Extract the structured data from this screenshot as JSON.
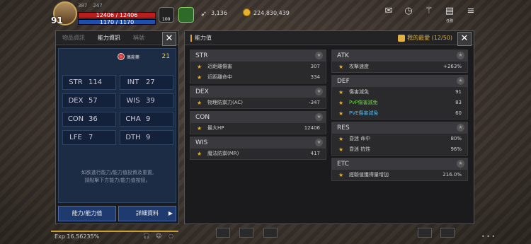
{
  "hud": {
    "level": "91",
    "hp_text": "12406 / 12406",
    "mp_text": "1170 / 1170",
    "stat_a": "387",
    "stat_b": "247",
    "wing_value": "3,136",
    "gold": "224,830,439",
    "pet_num": "100",
    "menu_labels": [
      "",
      "",
      "",
      "任務"
    ]
  },
  "left_panel": {
    "tabs": [
      "物品資訊",
      "能力資訊",
      "稱號"
    ],
    "elixir_label": "萬能藥",
    "elixir_value": "21",
    "stats": [
      {
        "key": "STR",
        "value": "114"
      },
      {
        "key": "INT",
        "value": "27"
      },
      {
        "key": "DEX",
        "value": "57"
      },
      {
        "key": "WIS",
        "value": "39"
      },
      {
        "key": "CON",
        "value": "36"
      },
      {
        "key": "CHA",
        "value": "9"
      },
      {
        "key": "LFE",
        "value": "7"
      },
      {
        "key": "DTH",
        "value": "9"
      }
    ],
    "hint_line1": "如欲進行能力/能力值投資及重置,",
    "hint_line2": "請點擊下方能力/能力值按鈕。",
    "btn_ability": "能力/能力值",
    "btn_detail": "詳細資料"
  },
  "right_panel": {
    "title": "能力值",
    "favorites": "我的最愛 (12/50)",
    "left_sections": [
      {
        "name": "STR",
        "rows": [
          {
            "label": "近距離傷害",
            "value": "307",
            "style": ""
          },
          {
            "label": "近距離命中",
            "value": "334",
            "style": ""
          }
        ]
      },
      {
        "name": "DEX",
        "rows": [
          {
            "label": "物理防禦力(AC)",
            "value": "-347",
            "style": ""
          }
        ]
      },
      {
        "name": "CON",
        "rows": [
          {
            "label": "最大HP",
            "value": "12406",
            "style": ""
          }
        ]
      },
      {
        "name": "WIS",
        "rows": [
          {
            "label": "魔法防禦(MR)",
            "value": "417",
            "style": ""
          }
        ]
      }
    ],
    "right_sections": [
      {
        "name": "ATK",
        "rows": [
          {
            "label": "攻擊速度",
            "value": "+263%",
            "style": ""
          }
        ]
      },
      {
        "name": "DEF",
        "rows": [
          {
            "label": "傷害減免",
            "value": "91",
            "style": ""
          },
          {
            "label": "PvP傷害減免",
            "value": "83",
            "style": "green"
          },
          {
            "label": "PVE傷害減免",
            "value": "60",
            "style": "blue"
          }
        ]
      },
      {
        "name": "RES",
        "rows": [
          {
            "label": "昏迷 命中",
            "value": "80%",
            "style": ""
          },
          {
            "label": "昏迷 抗性",
            "value": "96%",
            "style": ""
          }
        ]
      },
      {
        "name": "ETC",
        "rows": [
          {
            "label": "經驗值獲得量增加",
            "value": "216.0%",
            "style": ""
          }
        ]
      }
    ]
  },
  "bottom": {
    "exp": "Exp  16.56235%"
  }
}
